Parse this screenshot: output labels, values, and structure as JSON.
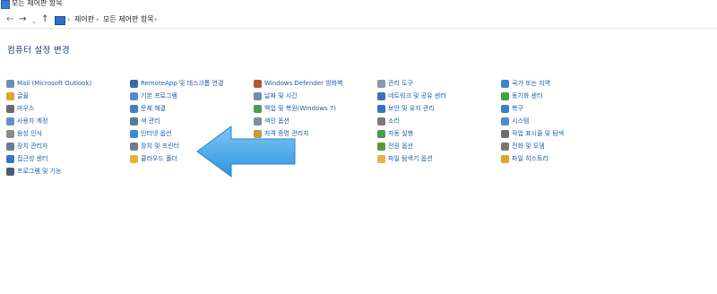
{
  "window": {
    "title": "모든 제어판 항목"
  },
  "nav": {
    "back": "←",
    "forward": "→",
    "recent": "⌄",
    "up": "↑",
    "breadcrumb": [
      "제어판",
      "모든 제어판 항목"
    ],
    "sep": "›"
  },
  "page_title": "컴퓨터 설정 변경",
  "items": [
    {
      "label": "Mail (Microsoft Outlook)",
      "icon": "mail-icon",
      "color": "#6d8fb3"
    },
    {
      "label": "글꼴",
      "icon": "fonts-icon",
      "color": "#e0a52a"
    },
    {
      "label": "마우스",
      "icon": "mouse-icon",
      "color": "#6b6b6b"
    },
    {
      "label": "사용자 계정",
      "icon": "user-accounts-icon",
      "color": "#6a8fc7"
    },
    {
      "label": "음성 인식",
      "icon": "speech-recognition-icon",
      "color": "#8c8c8c"
    },
    {
      "label": "장치 관리자",
      "icon": "device-manager-icon",
      "color": "#6a7f95"
    },
    {
      "label": "접근성 센터",
      "icon": "ease-of-access-icon",
      "color": "#3a73c6"
    },
    {
      "label": "프로그램 및 기능",
      "icon": "programs-features-icon",
      "color": "#4a5a70"
    },
    {
      "label": "RemoteApp 및 데스크톱 연결",
      "icon": "remoteapp-icon",
      "color": "#3a66b0"
    },
    {
      "label": "기본 프로그램",
      "icon": "default-programs-icon",
      "color": "#4f8fd6"
    },
    {
      "label": "문제 해결",
      "icon": "troubleshooting-icon",
      "color": "#4a7cc2"
    },
    {
      "label": "색 관리",
      "icon": "color-management-icon",
      "color": "#5c7a9c"
    },
    {
      "label": "인터넷 옵션",
      "icon": "internet-options-icon",
      "color": "#3a8bd4"
    },
    {
      "label": "장치 및 프린터",
      "icon": "devices-printers-icon",
      "color": "#6d7d8d"
    },
    {
      "label": "클라우드 폴더",
      "icon": "cloud-folder-icon",
      "color": "#e8b530"
    },
    {
      "label": "Windows Defender 방화벽",
      "icon": "firewall-icon",
      "color": "#b5562c"
    },
    {
      "label": "날짜 및 시간",
      "icon": "date-time-icon",
      "color": "#6f8fb7"
    },
    {
      "label": "백업 및 복원(Windows 7)",
      "icon": "backup-restore-icon",
      "color": "#4c9a4c"
    },
    {
      "label": "색인 옵션",
      "icon": "indexing-options-icon",
      "color": "#7f8ea0"
    },
    {
      "label": "자격 증명 관리자",
      "icon": "credential-manager-icon",
      "color": "#c79a3c"
    },
    {
      "label": "저장소 공간",
      "icon": "storage-spaces-icon",
      "color": "#7a8694"
    },
    {
      "label": "키보드",
      "icon": "keyboard-icon",
      "color": "#6b6b6b"
    },
    {
      "label": "관리 도구",
      "icon": "admin-tools-icon",
      "color": "#8a9aab"
    },
    {
      "label": "네트워크 및 공유 센터",
      "icon": "network-sharing-icon",
      "color": "#3f6fb5"
    },
    {
      "label": "보안 및 유지 관리",
      "icon": "security-maintenance-icon",
      "color": "#3c6fc4"
    },
    {
      "label": "소리",
      "icon": "sound-icon",
      "color": "#7a7a7a"
    },
    {
      "label": "자동 실행",
      "icon": "autoplay-icon",
      "color": "#4b9a53"
    },
    {
      "label": "전원 옵션",
      "icon": "power-options-icon",
      "color": "#5a9a3f"
    },
    {
      "label": "파일 탐색기 옵션",
      "icon": "file-explorer-options-icon",
      "color": "#e3b53a"
    },
    {
      "label": "국가 또는 지역",
      "icon": "region-icon",
      "color": "#3a86c9"
    },
    {
      "label": "동기화 센터",
      "icon": "sync-center-icon",
      "color": "#3ea33e"
    },
    {
      "label": "복구",
      "icon": "recovery-icon",
      "color": "#3c7fc8"
    },
    {
      "label": "시스템",
      "icon": "system-icon",
      "color": "#4f8bc9"
    },
    {
      "label": "작업 표시줄 및 탐색",
      "icon": "taskbar-navigation-icon",
      "color": "#6d6d6d"
    },
    {
      "label": "전화 및 모뎀",
      "icon": "phone-modem-icon",
      "color": "#777777"
    },
    {
      "label": "파일 히스토리",
      "icon": "file-history-icon",
      "color": "#e0a42a"
    }
  ],
  "accent": "#4aa8e8"
}
